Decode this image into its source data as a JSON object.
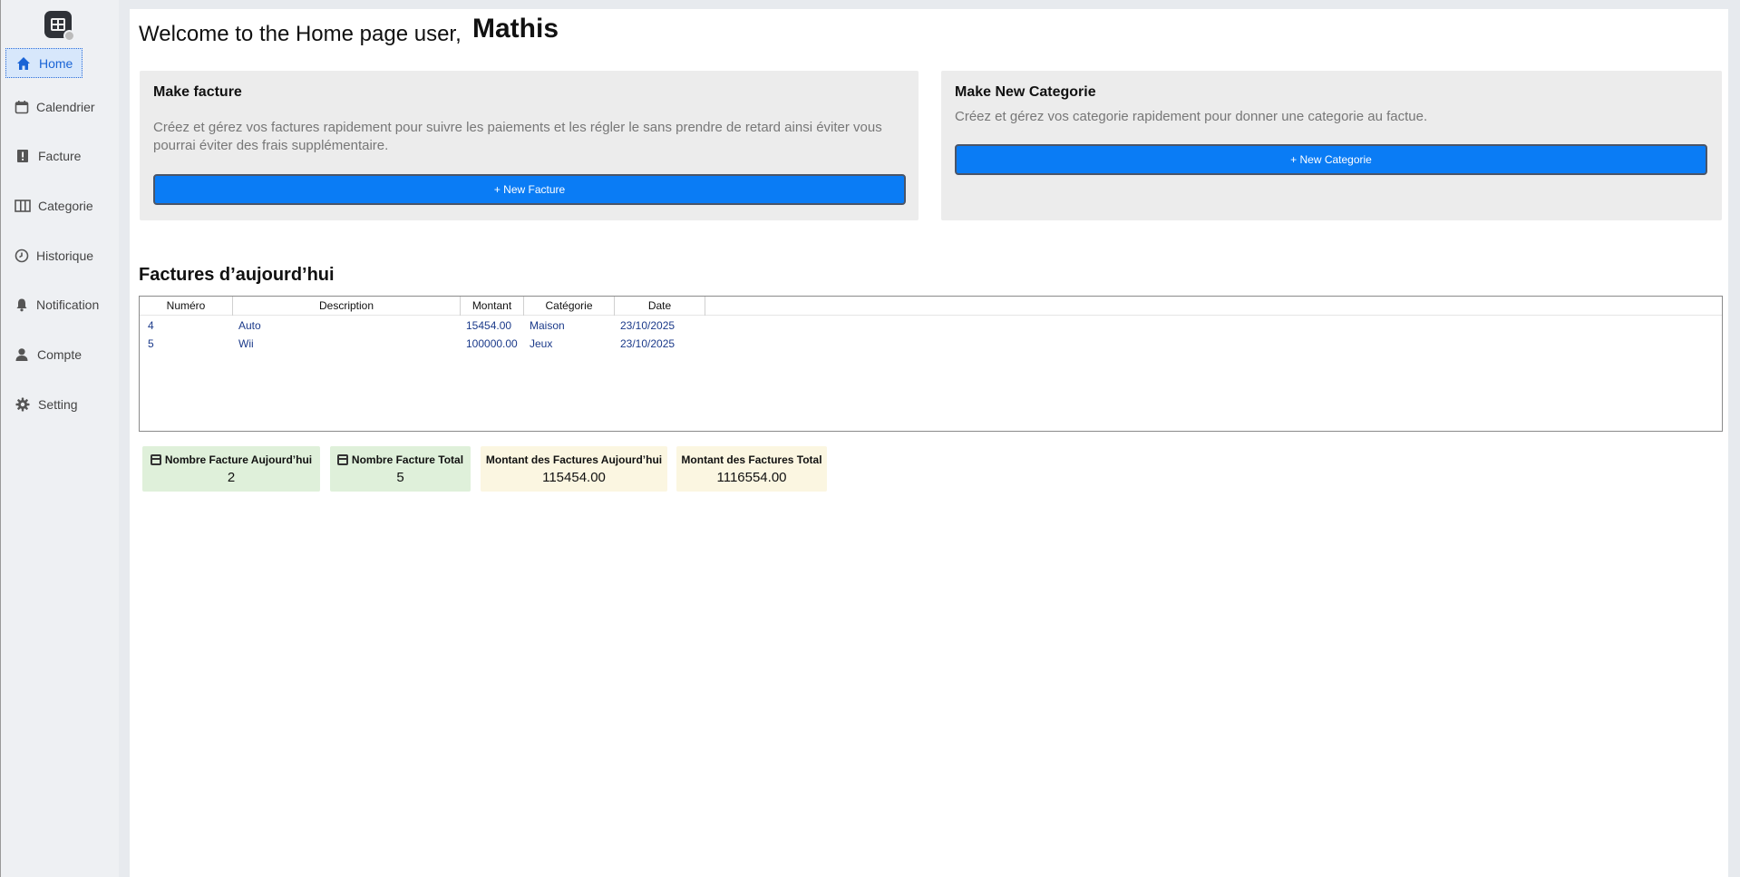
{
  "sidebar": {
    "items": [
      {
        "label": "Home",
        "icon": "home-icon"
      },
      {
        "label": "Calendrier",
        "icon": "calendar-icon"
      },
      {
        "label": "Facture",
        "icon": "alert-icon"
      },
      {
        "label": "Categorie",
        "icon": "columns-icon"
      },
      {
        "label": "Historique",
        "icon": "history-icon"
      },
      {
        "label": "Notification",
        "icon": "bell-icon"
      },
      {
        "label": "Compte",
        "icon": "user-icon"
      },
      {
        "label": "Setting",
        "icon": "gear-icon"
      }
    ],
    "active": "Home"
  },
  "header": {
    "welcome": "Welcome to the Home page user,",
    "username": "Mathis"
  },
  "cards": {
    "facture": {
      "title": "Make facture",
      "description": "Créez et gérez vos factures rapidement pour suivre les paiements et les régler le sans prendre de retard ainsi éviter vous pourrai éviter des frais supplémentaire.",
      "button": "+ New Facture"
    },
    "categorie": {
      "title": "Make New Categorie",
      "description": "Créez et gérez vos categorie rapidement pour donner une categorie au factue.",
      "button": "+ New Categorie"
    }
  },
  "today": {
    "title": "Factures d’aujourd’hui",
    "columns": [
      "Numéro",
      "Description",
      "Montant",
      "Catégorie",
      "Date"
    ],
    "rows": [
      {
        "numero": "4",
        "description": "Auto",
        "montant": "15454.00",
        "categorie": "Maison",
        "date": "23/10/2025"
      },
      {
        "numero": "5",
        "description": "Wii",
        "montant": "100000.00",
        "categorie": "Jeux",
        "date": "23/10/2025"
      }
    ]
  },
  "stats": [
    {
      "label": "Nombre Facture Aujourd’hui",
      "value": "2"
    },
    {
      "label": "Nombre Facture Total",
      "value": "5"
    },
    {
      "label": "Montant des Factures Aujourd’hui",
      "value": "115454.00"
    },
    {
      "label": "Montant des Factures Total",
      "value": "1116554.00"
    }
  ],
  "colors": {
    "accent": "#0a7cf5",
    "active_nav_bg": "#d7e7fb",
    "table_text": "#1b3a8a",
    "stat_green": "#dff0da",
    "stat_yellow": "#fbf6e1"
  }
}
